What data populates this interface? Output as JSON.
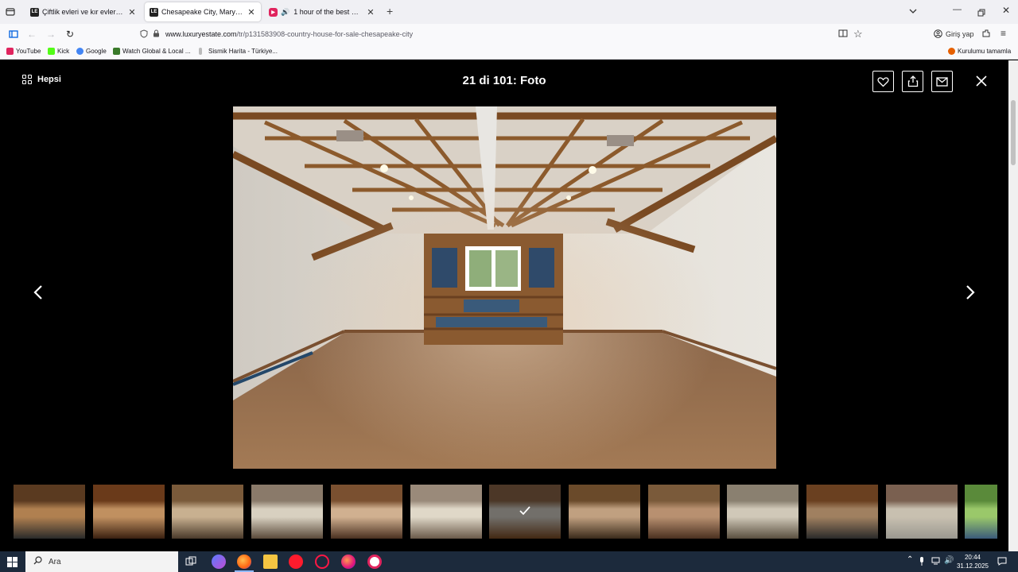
{
  "browser": {
    "tabs": [
      {
        "title": "Çiftlik evleri ve kır evleri satılık - A",
        "favicon": "LE",
        "active": false,
        "audio": false
      },
      {
        "title": "Chesapeake City, Maryland, sat",
        "favicon": "LE",
        "active": true,
        "audio": false
      },
      {
        "title": "1 hour of the best Christma",
        "favicon": "YT",
        "active": false,
        "audio": true
      }
    ],
    "new_tab_label": "+",
    "url": {
      "host": "www.luxuryestate.com",
      "path": "/tr/p131583908-country-house-for-sale-chesapeake-city"
    },
    "signin_label": "Giriş yap",
    "bookmarks": [
      {
        "label": "YouTube",
        "color": "#e0245e"
      },
      {
        "label": "Kick",
        "color": "#53fc18"
      },
      {
        "label": "Google",
        "color": "#4285f4"
      },
      {
        "label": "Watch Global & Local ...",
        "color": "#3a7a2a"
      },
      {
        "label": "Sismik Harita - Türkiye...",
        "color": "#bbbbbb"
      }
    ],
    "bookmarks_overflow": "Kurulumu tamamla"
  },
  "gallery": {
    "all_label": "Hepsi",
    "title": "21 di 101: Foto",
    "current_index": 21,
    "total": 101,
    "thumbnails": [
      {
        "selected": false
      },
      {
        "selected": false
      },
      {
        "selected": false
      },
      {
        "selected": false
      },
      {
        "selected": false
      },
      {
        "selected": false
      },
      {
        "selected": true
      },
      {
        "selected": false
      },
      {
        "selected": false
      },
      {
        "selected": false
      },
      {
        "selected": false
      },
      {
        "selected": false
      },
      {
        "selected": false
      }
    ]
  },
  "taskbar": {
    "search_placeholder": "Ara",
    "time": "20:44",
    "date": "31.12.2025"
  },
  "colors": {
    "viewer_bg": "#000000",
    "taskbar_bg": "#1c2a3c",
    "wood": "#8a5a30",
    "floor": "#9c7552"
  }
}
